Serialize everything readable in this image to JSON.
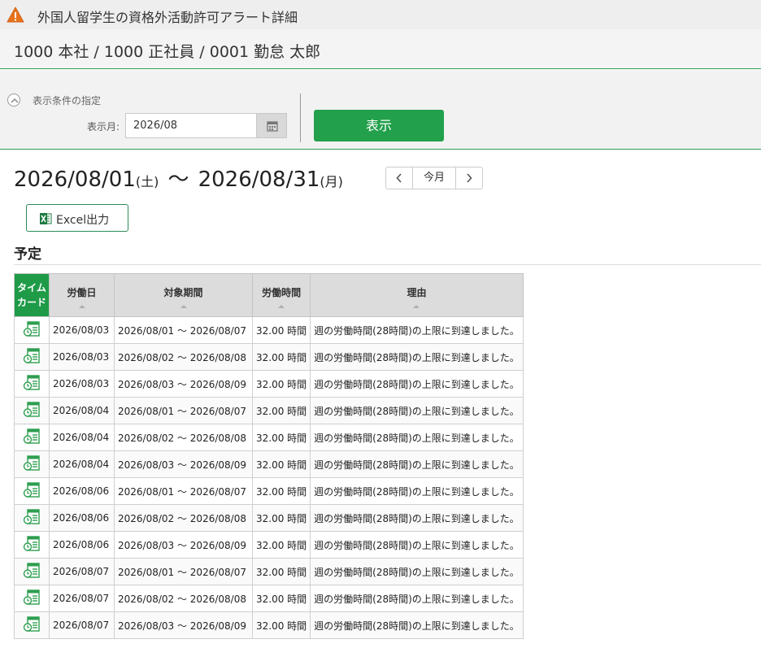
{
  "header": {
    "title": "外国人留学生の資格外活動許可アラート詳細",
    "warning_icon": "warning-icon"
  },
  "employee": {
    "name": "1000 本社 / 1000 正社員 / 0001 勤怠 太郎"
  },
  "condition": {
    "toggle_label": "表示条件の指定",
    "month_label": "表示月:",
    "month_value": "2026/08",
    "show_button": "表示"
  },
  "range": {
    "start": "2026/08/01",
    "start_wd": "(土)",
    "sep": "〜",
    "end": "2026/08/31",
    "end_wd": "(月)"
  },
  "nav": {
    "today": "今月"
  },
  "excel_button": "Excel出力",
  "section": {
    "title": "予定"
  },
  "table": {
    "headers": {
      "timecard_1": "タイム",
      "timecard_2": "カード",
      "work_date": "労働日",
      "period": "対象期間",
      "hours": "労働時間",
      "reason": "理由"
    },
    "rows": [
      {
        "date": "2026/08/03",
        "period": "2026/08/01 〜 2026/08/07",
        "hours": "32.00 時間",
        "reason": "週の労働時間(28時間)の上限に到達しました。"
      },
      {
        "date": "2026/08/03",
        "period": "2026/08/02 〜 2026/08/08",
        "hours": "32.00 時間",
        "reason": "週の労働時間(28時間)の上限に到達しました。"
      },
      {
        "date": "2026/08/03",
        "period": "2026/08/03 〜 2026/08/09",
        "hours": "32.00 時間",
        "reason": "週の労働時間(28時間)の上限に到達しました。"
      },
      {
        "date": "2026/08/04",
        "period": "2026/08/01 〜 2026/08/07",
        "hours": "32.00 時間",
        "reason": "週の労働時間(28時間)の上限に到達しました。"
      },
      {
        "date": "2026/08/04",
        "period": "2026/08/02 〜 2026/08/08",
        "hours": "32.00 時間",
        "reason": "週の労働時間(28時間)の上限に到達しました。"
      },
      {
        "date": "2026/08/04",
        "period": "2026/08/03 〜 2026/08/09",
        "hours": "32.00 時間",
        "reason": "週の労働時間(28時間)の上限に到達しました。"
      },
      {
        "date": "2026/08/06",
        "period": "2026/08/01 〜 2026/08/07",
        "hours": "32.00 時間",
        "reason": "週の労働時間(28時間)の上限に到達しました。"
      },
      {
        "date": "2026/08/06",
        "period": "2026/08/02 〜 2026/08/08",
        "hours": "32.00 時間",
        "reason": "週の労働時間(28時間)の上限に到達しました。"
      },
      {
        "date": "2026/08/06",
        "period": "2026/08/03 〜 2026/08/09",
        "hours": "32.00 時間",
        "reason": "週の労働時間(28時間)の上限に到達しました。"
      },
      {
        "date": "2026/08/07",
        "period": "2026/08/01 〜 2026/08/07",
        "hours": "32.00 時間",
        "reason": "週の労働時間(28時間)の上限に到達しました。"
      },
      {
        "date": "2026/08/07",
        "period": "2026/08/02 〜 2026/08/08",
        "hours": "32.00 時間",
        "reason": "週の労働時間(28時間)の上限に到達しました。"
      },
      {
        "date": "2026/08/07",
        "period": "2026/08/03 〜 2026/08/09",
        "hours": "32.00 時間",
        "reason": "週の労働時間(28時間)の上限に到達しました。"
      }
    ]
  },
  "colors": {
    "accent": "#22a04b",
    "warning": "#e8731a"
  }
}
